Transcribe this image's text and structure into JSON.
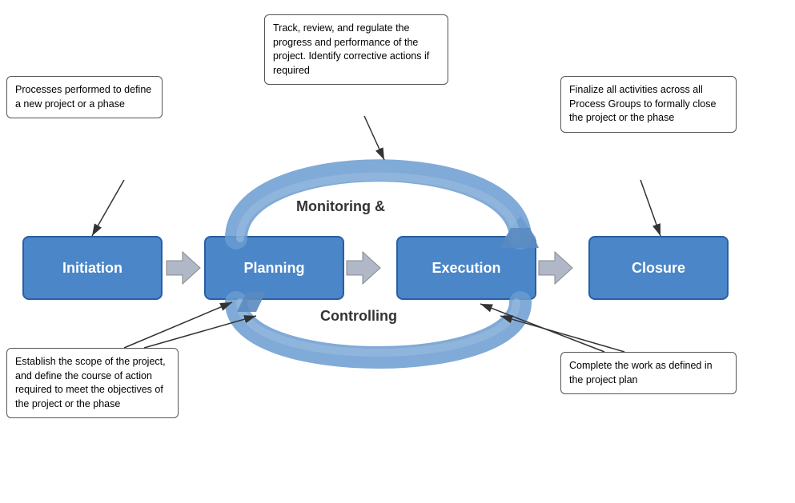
{
  "phases": {
    "initiation": {
      "label": "Initiation"
    },
    "planning": {
      "label": "Planning"
    },
    "execution": {
      "label": "Execution"
    },
    "closure": {
      "label": "Closure"
    }
  },
  "callouts": {
    "initiation": "Processes performed to define a new project or a phase",
    "monitoring": "Track, review, and regulate the progress and performance of the project. Identify corrective actions if required",
    "closure": "Finalize all activities across all Process Groups to formally close the project or the phase",
    "planning": "Establish the scope of the project, and define the course of action required to meet the objectives of the project or the phase",
    "execution": "Complete the work as defined in the project plan"
  },
  "labels": {
    "monitoring": "Monitoring &",
    "controlling": "Controlling"
  }
}
